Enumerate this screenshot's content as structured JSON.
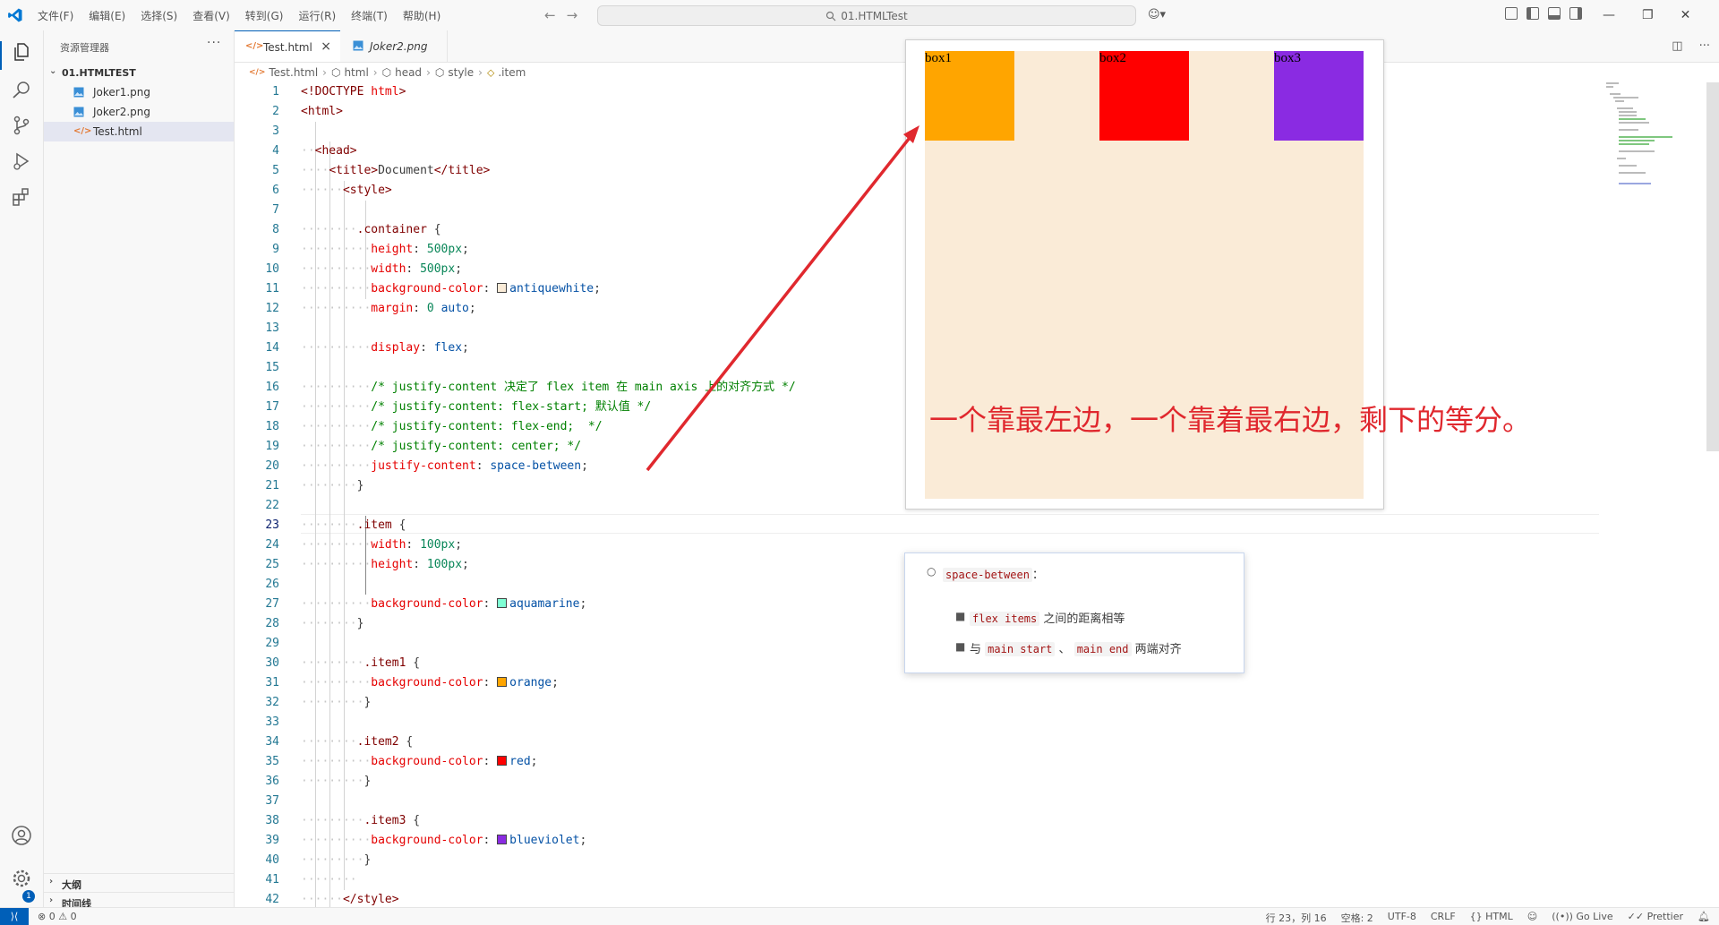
{
  "menu": [
    "文件(F)",
    "编辑(E)",
    "选择(S)",
    "查看(V)",
    "转到(G)",
    "运行(R)",
    "终端(T)",
    "帮助(H)"
  ],
  "title": "01.HTMLTest",
  "sidebar": {
    "title": "资源管理器",
    "more": "···",
    "folder": "01.HTMLTEST",
    "files": [
      "Joker1.png",
      "Joker2.png",
      "Test.html"
    ],
    "outline": "大纲",
    "timeline": "时间线"
  },
  "tabs": [
    {
      "label": "Test.html",
      "close": "×"
    },
    {
      "label": "Joker2.png"
    }
  ],
  "breadcrumb": [
    "Test.html",
    "html",
    "head",
    "style",
    ".item"
  ],
  "current_line": 23,
  "accent": "#005fb8",
  "activity_badge": "1",
  "preview": {
    "items": [
      {
        "label": "box1",
        "color": "orange"
      },
      {
        "label": "box2",
        "color": "red"
      },
      {
        "label": "box3",
        "color": "blueviolet"
      }
    ],
    "container_color": "antiquewhite"
  },
  "note": "一个靠最左边，一个靠着最右边，剩下的等分。",
  "popup": {
    "term": "space-between",
    "colon": "：",
    "b1_code": "flex items",
    "b1_text": "之间的距离相等",
    "b2_pre": "与",
    "b2_code1": "main start",
    "b2_sep": "、",
    "b2_code2": "main end",
    "b2_text": "两端对齐"
  },
  "status": {
    "errors": "0",
    "warnings": "0",
    "position": "行 23，列 16",
    "spaces": "空格: 2",
    "encoding": "UTF-8",
    "eol": "CRLF",
    "language": "HTML",
    "golive": "Go Live",
    "prettier": "Prettier"
  }
}
